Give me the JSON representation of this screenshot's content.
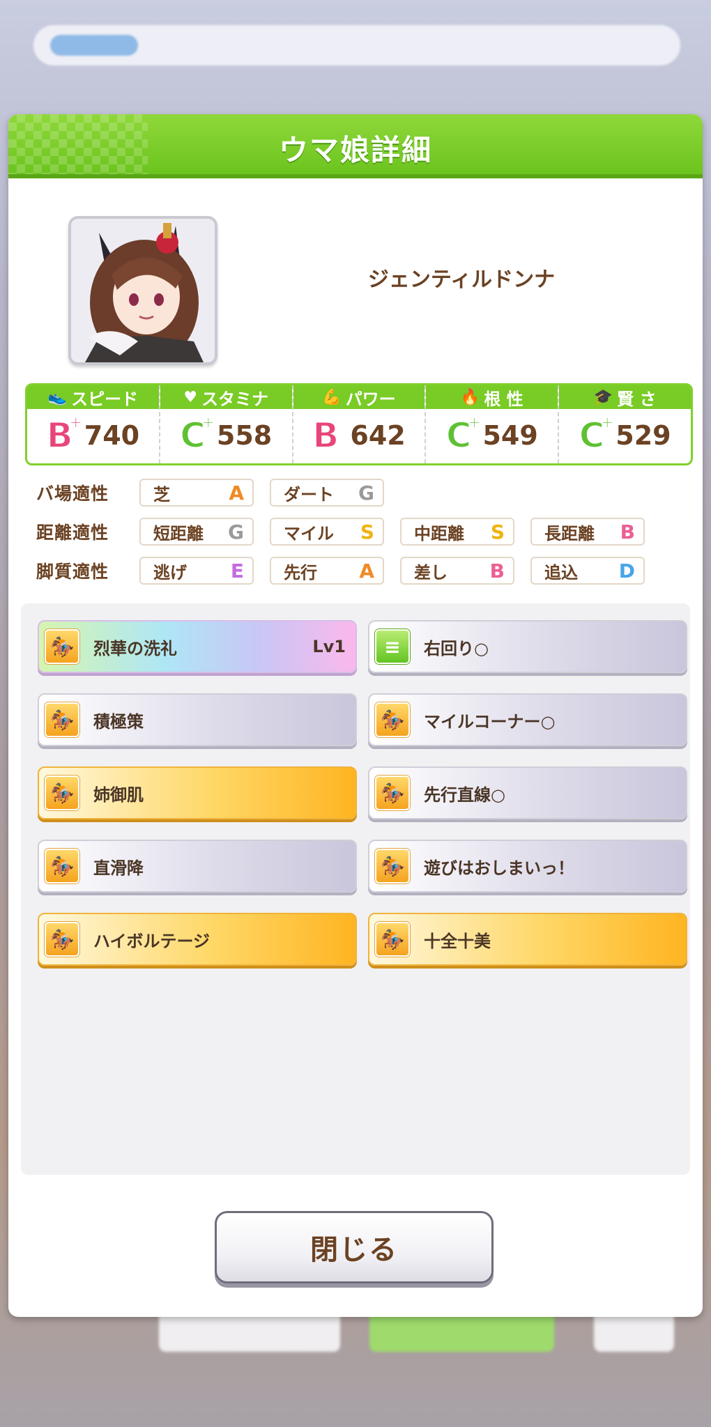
{
  "dialog": {
    "title": "ウマ娘詳細",
    "close_label": "閉じる"
  },
  "character": {
    "name": "ジェンティルドンナ"
  },
  "stats": [
    {
      "label": "スピード",
      "icon": "shoe-icon",
      "grade": "B",
      "plus": "+",
      "grade_color": "#e8467a",
      "value": "740"
    },
    {
      "label": "スタミナ",
      "icon": "heart-icon",
      "grade": "C",
      "plus": "+",
      "grade_color": "#5ec133",
      "value": "558"
    },
    {
      "label": "パワー",
      "icon": "muscle-icon",
      "grade": "B",
      "plus": "",
      "grade_color": "#e8467a",
      "value": "642"
    },
    {
      "label": "根 性",
      "icon": "flame-icon",
      "grade": "C",
      "plus": "+",
      "grade_color": "#5ec133",
      "value": "549"
    },
    {
      "label": "賢 さ",
      "icon": "graduation-cap-icon",
      "grade": "C",
      "plus": "+",
      "grade_color": "#5ec133",
      "value": "529"
    }
  ],
  "aptitude": {
    "track": {
      "label": "バ場適性",
      "items": [
        {
          "name": "芝",
          "grade": "A"
        },
        {
          "name": "ダート",
          "grade": "G"
        }
      ]
    },
    "distance": {
      "label": "距離適性",
      "items": [
        {
          "name": "短距離",
          "grade": "G"
        },
        {
          "name": "マイル",
          "grade": "S"
        },
        {
          "name": "中距離",
          "grade": "S"
        },
        {
          "name": "長距離",
          "grade": "B"
        }
      ]
    },
    "style": {
      "label": "脚質適性",
      "items": [
        {
          "name": "逃げ",
          "grade": "E"
        },
        {
          "name": "先行",
          "grade": "A"
        },
        {
          "name": "差し",
          "grade": "B"
        },
        {
          "name": "追込",
          "grade": "D"
        }
      ]
    }
  },
  "skills": [
    {
      "name": "烈華の洗礼",
      "level": "Lv1",
      "style": "rainbow",
      "icon": "running-figure-icon"
    },
    {
      "name": "右回り○",
      "level": "",
      "style": "gray",
      "icon": "track-direction-icon"
    },
    {
      "name": "積極策",
      "level": "",
      "style": "gray",
      "icon": "running-figure-icon"
    },
    {
      "name": "マイルコーナー○",
      "level": "",
      "style": "gray",
      "icon": "running-figure-icon"
    },
    {
      "name": "姉御肌",
      "level": "",
      "style": "gold",
      "icon": "running-figure-icon"
    },
    {
      "name": "先行直線○",
      "level": "",
      "style": "gray",
      "icon": "running-figure-icon"
    },
    {
      "name": "直滑降",
      "level": "",
      "style": "gray",
      "icon": "running-figure-icon"
    },
    {
      "name": "遊びはおしまいっ！",
      "level": "",
      "style": "gray",
      "icon": "running-figure-icon"
    },
    {
      "name": "ハイボルテージ",
      "level": "",
      "style": "gold",
      "icon": "running-figure-icon"
    },
    {
      "name": "十全十美",
      "level": "",
      "style": "gold",
      "icon": "running-figure-icon"
    }
  ]
}
